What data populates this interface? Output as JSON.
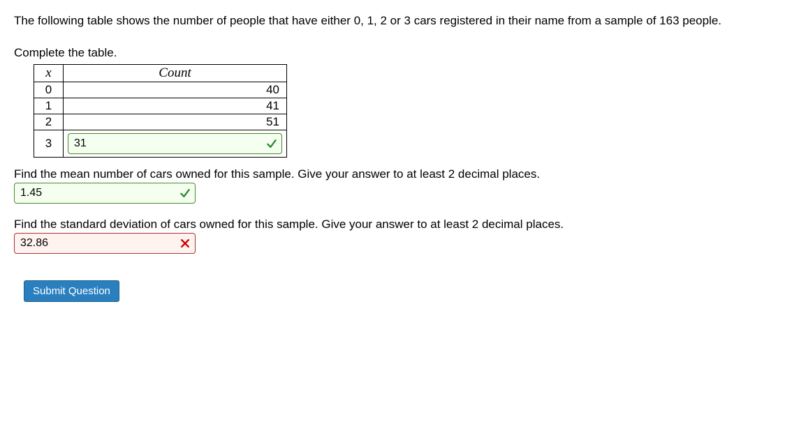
{
  "intro": "The following table shows the number of people that have either 0, 1, 2 or 3 cars registered in their name from a sample of 163 people.",
  "complete_label": "Complete the table.",
  "table": {
    "header_x": "x",
    "header_count": "Count",
    "rows": [
      {
        "x": "0",
        "count": "40"
      },
      {
        "x": "1",
        "count": "41"
      },
      {
        "x": "2",
        "count": "51"
      }
    ],
    "input_row": {
      "x": "3",
      "value": "31",
      "correct": true
    }
  },
  "q_mean": {
    "prompt": "Find the mean number of cars owned for this sample. Give your answer to at least 2 decimal places.",
    "value": "1.45",
    "correct": true
  },
  "q_sd": {
    "prompt": "Find the standard deviation of cars owned for this sample. Give your answer to at least 2 decimal places.",
    "value": "32.86",
    "correct": false
  },
  "submit_label": "Submit Question",
  "chart_data": {
    "type": "table",
    "title": "Car ownership counts",
    "columns": [
      "x",
      "Count"
    ],
    "rows": [
      [
        0,
        40
      ],
      [
        1,
        41
      ],
      [
        2,
        51
      ],
      [
        3,
        31
      ]
    ],
    "sample_size": 163
  }
}
